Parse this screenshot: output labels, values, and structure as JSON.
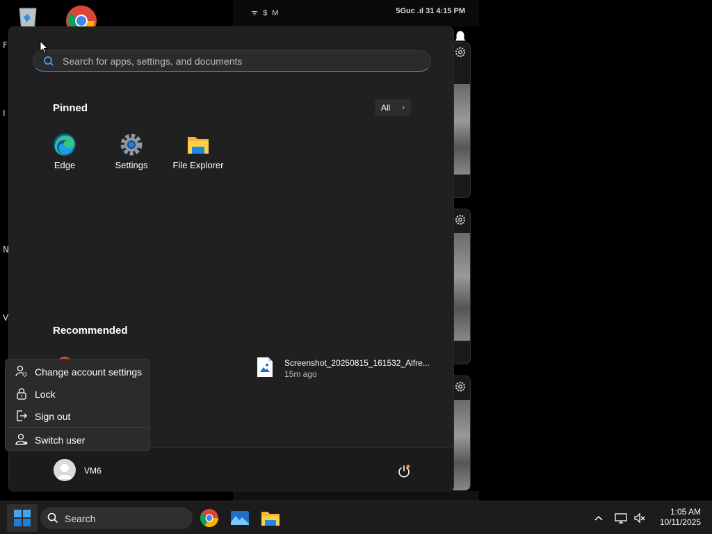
{
  "phone": {
    "status_left": "ᯤ $ M",
    "status_right": "5Guc .ıl 31 4:15 PM"
  },
  "start_menu": {
    "search_placeholder": "Search for apps, settings, and documents",
    "pinned_title": "Pinned",
    "all_label": "All",
    "pinned_apps": [
      {
        "label": "Edge",
        "icon": "edge-icon"
      },
      {
        "label": "Settings",
        "icon": "settings-gear-icon"
      },
      {
        "label": "File Explorer",
        "icon": "folder-icon"
      }
    ],
    "recommended_title": "Recommended",
    "recommended": [
      {
        "name": "Screenshot_20250815_161532_Alfre...",
        "time": "15m ago",
        "icon": "image-file-icon"
      }
    ],
    "user_name": "VM6"
  },
  "account_menu": {
    "items": [
      {
        "label": "Change account settings",
        "icon": "user-settings-icon"
      },
      {
        "label": "Lock",
        "icon": "lock-icon"
      },
      {
        "label": "Sign out",
        "icon": "sign-out-icon"
      },
      {
        "label": "Switch user",
        "icon": "switch-user-icon"
      }
    ]
  },
  "taskbar": {
    "search_label": "Search",
    "apps": [
      "chrome-icon",
      "photos-icon",
      "file-explorer-icon"
    ],
    "time": "1:05 AM",
    "date": "10/11/2025"
  },
  "colors": {
    "start_bg": "#202020",
    "taskbar_bg": "#1c1c1c",
    "accent": "#4a90d9"
  }
}
